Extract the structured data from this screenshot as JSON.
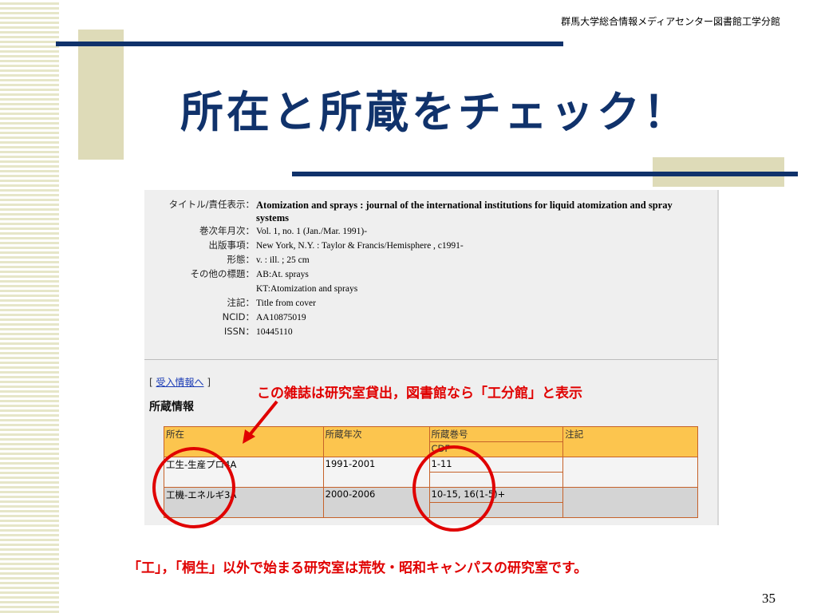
{
  "header": {
    "caption": "群馬大学総合情報メディアセンター図書館工学分館",
    "title": "所在と所蔵をチェック！"
  },
  "record": {
    "fields": [
      {
        "label": "タイトル/責任表示：",
        "value": "Atomization and sprays : journal of the international institutions for liquid atomization and spray systems",
        "bold": true
      },
      {
        "label": "巻次年月次：",
        "value": "Vol. 1, no. 1 (Jan./Mar. 1991)-"
      },
      {
        "label": "出版事項：",
        "value": "New York, N.Y. : Taylor & Francis/Hemisphere , c1991-"
      },
      {
        "label": "形態：",
        "value": "v. : ill. ; 25 cm"
      },
      {
        "label": "その他の標題：",
        "value": "AB:At. sprays"
      },
      {
        "label": "",
        "value": "KT:Atomization and sprays"
      },
      {
        "label": "注記：",
        "value": "Title from cover"
      },
      {
        "label": "NCID：",
        "value": "AA10875019"
      },
      {
        "label": "ISSN：",
        "value": "10445110"
      }
    ],
    "accept_link": {
      "prefix": "[ ",
      "label": "受入情報へ",
      "suffix": " ]"
    },
    "holdings_heading": "所蔵情報"
  },
  "holdings": {
    "headers": [
      "所在",
      "所蔵年次",
      "所蔵巻号",
      "注記"
    ],
    "subheader": "CDF",
    "rows": [
      {
        "location": "工生-生産プロ4A",
        "years": "1991-2001",
        "volumes": "1-11",
        "note": ""
      },
      {
        "location": "工機-エネルギ3A",
        "years": "2000-2006",
        "volumes": "10-15, 16(1-5)+",
        "note": ""
      }
    ]
  },
  "annotations": {
    "callout": "この雑誌は研究室貸出，図書館なら「工分館」と表示",
    "footer": "「工」，「桐生」以外で始まる研究室は荒牧・昭和キャンパスの研究室です。"
  },
  "page_number": "35",
  "colors": {
    "title": "#10326b",
    "annotation": "#e00000",
    "table_header": "#fcc54e",
    "table_border": "#c6622a",
    "deco_block": "#dedbb8"
  }
}
